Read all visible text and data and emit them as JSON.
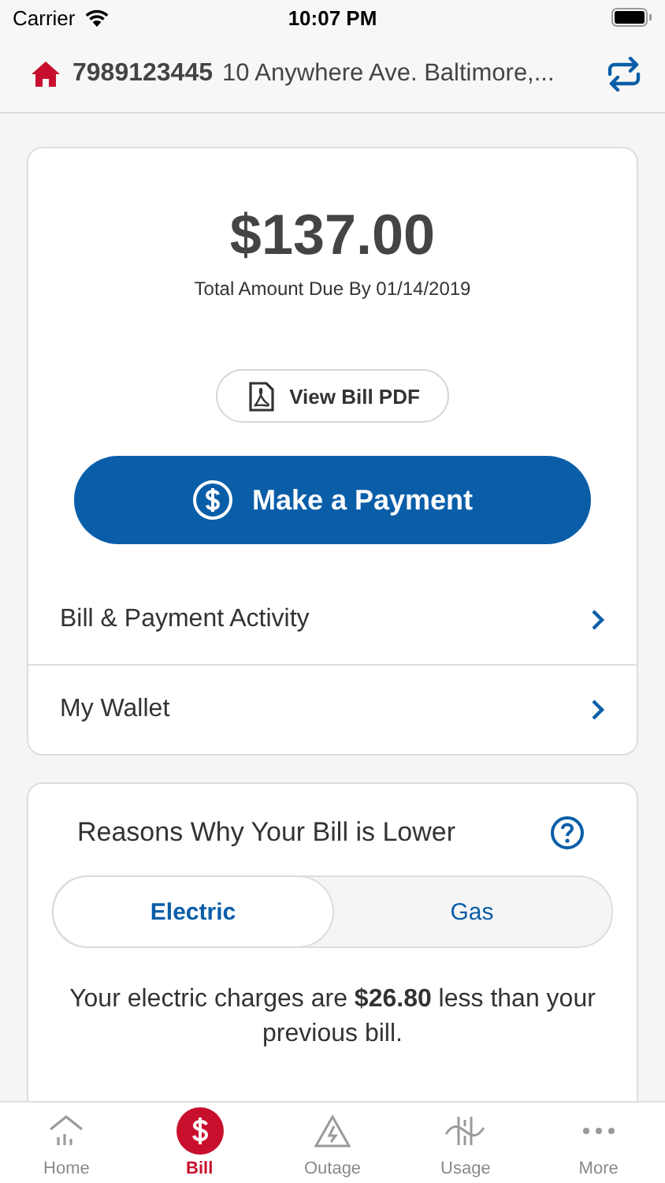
{
  "status_bar": {
    "carrier": "Carrier",
    "time": "10:07 PM"
  },
  "account": {
    "number": "7989123445",
    "address": "10 Anywhere Ave. Baltimore,..."
  },
  "bill": {
    "amount": "$137.00",
    "due": "Total Amount Due By 01/14/2019",
    "pdf_button": "View Bill PDF",
    "pay_button": "Make a Payment",
    "links": [
      {
        "label": "Bill & Payment Activity"
      },
      {
        "label": "My Wallet"
      }
    ]
  },
  "reasons": {
    "title": "Reasons Why Your Bill is Lower",
    "segments": [
      {
        "label": "Electric",
        "selected": true
      },
      {
        "label": "Gas",
        "selected": false
      }
    ],
    "message": "Your electric charges are **$26.80** less than your previous bill."
  },
  "tab_bar": [
    {
      "label": "Home",
      "selected": false
    },
    {
      "label": "Bill",
      "selected": true
    },
    {
      "label": "Outage",
      "selected": false
    },
    {
      "label": "Usage",
      "selected": false
    },
    {
      "label": "More",
      "selected": false
    }
  ]
}
